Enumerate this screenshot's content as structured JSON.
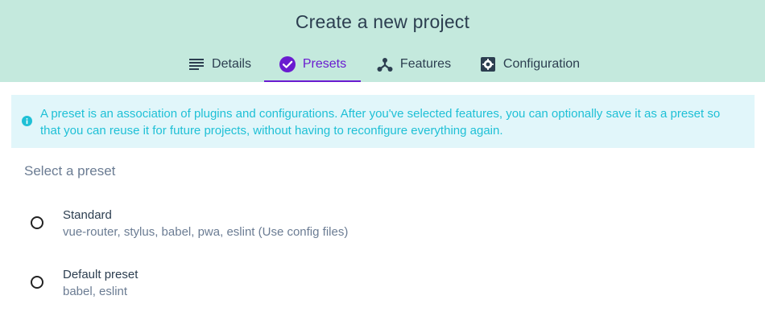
{
  "header": {
    "title": "Create a new project",
    "tabs": [
      {
        "label": "Details",
        "icon": "list-icon",
        "active": false
      },
      {
        "label": "Presets",
        "icon": "check-circle-icon",
        "active": true
      },
      {
        "label": "Features",
        "icon": "features-icon",
        "active": false
      },
      {
        "label": "Configuration",
        "icon": "settings-icon",
        "active": false
      }
    ]
  },
  "info": {
    "icon": "info-icon",
    "text": "A preset is an association of plugins and configurations. After you've selected features, you can optionally save it as a preset so that you can reuse it for future projects, without having to reconfigure everything again."
  },
  "presets_section": {
    "title": "Select a preset",
    "items": [
      {
        "name": "Standard",
        "description": "vue-router, stylus, babel, pwa, eslint (Use config files)",
        "selected": false
      },
      {
        "name": "Default preset",
        "description": "babel, eslint",
        "selected": false
      }
    ]
  },
  "colors": {
    "header_bg": "#c4e9dd",
    "accent": "#6a1bd0",
    "info_bg": "#e1f6fa",
    "info_text": "#1fc0d6",
    "text": "#2c3e50",
    "muted_text": "#6b7c93"
  }
}
